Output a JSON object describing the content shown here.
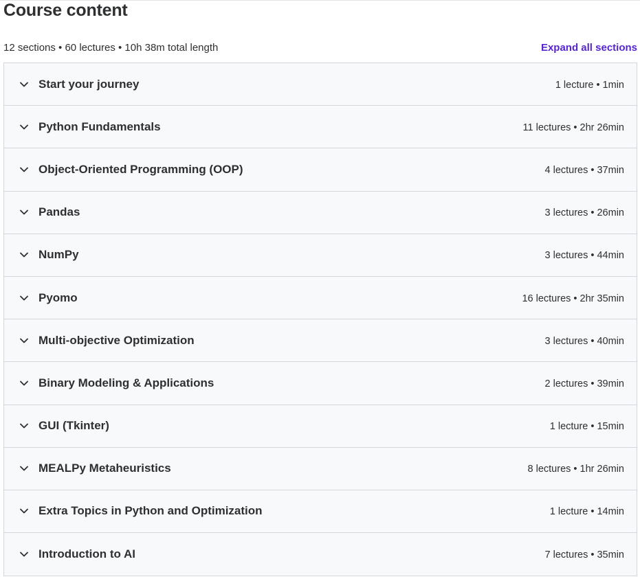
{
  "header": {
    "title": "Course content",
    "summary": "12 sections • 60 lectures • 10h 38m total length",
    "expand_label": "Expand all sections"
  },
  "colors": {
    "accent": "#5624d0",
    "text": "#2d2f31",
    "row_bg": "#f7f9fa",
    "border": "#d1d7dc"
  },
  "chevron_icon": "chevron-down-icon",
  "sections": [
    {
      "title": "Start your journey",
      "meta": "1 lecture • 1min"
    },
    {
      "title": "Python Fundamentals",
      "meta": "11 lectures • 2hr 26min"
    },
    {
      "title": "Object-Oriented Programming (OOP)",
      "meta": "4 lectures • 37min"
    },
    {
      "title": "Pandas",
      "meta": "3 lectures • 26min"
    },
    {
      "title": "NumPy",
      "meta": "3 lectures • 44min"
    },
    {
      "title": "Pyomo",
      "meta": "16 lectures • 2hr 35min"
    },
    {
      "title": "Multi-objective Optimization",
      "meta": "3 lectures • 40min"
    },
    {
      "title": "Binary Modeling & Applications",
      "meta": "2 lectures • 39min"
    },
    {
      "title": "GUI (Tkinter)",
      "meta": "1 lecture • 15min"
    },
    {
      "title": "MEALPy Metaheuristics",
      "meta": "8 lectures • 1hr 26min"
    },
    {
      "title": "Extra Topics in Python and Optimization",
      "meta": "1 lecture • 14min"
    },
    {
      "title": "Introduction to AI",
      "meta": "7 lectures • 35min"
    }
  ]
}
